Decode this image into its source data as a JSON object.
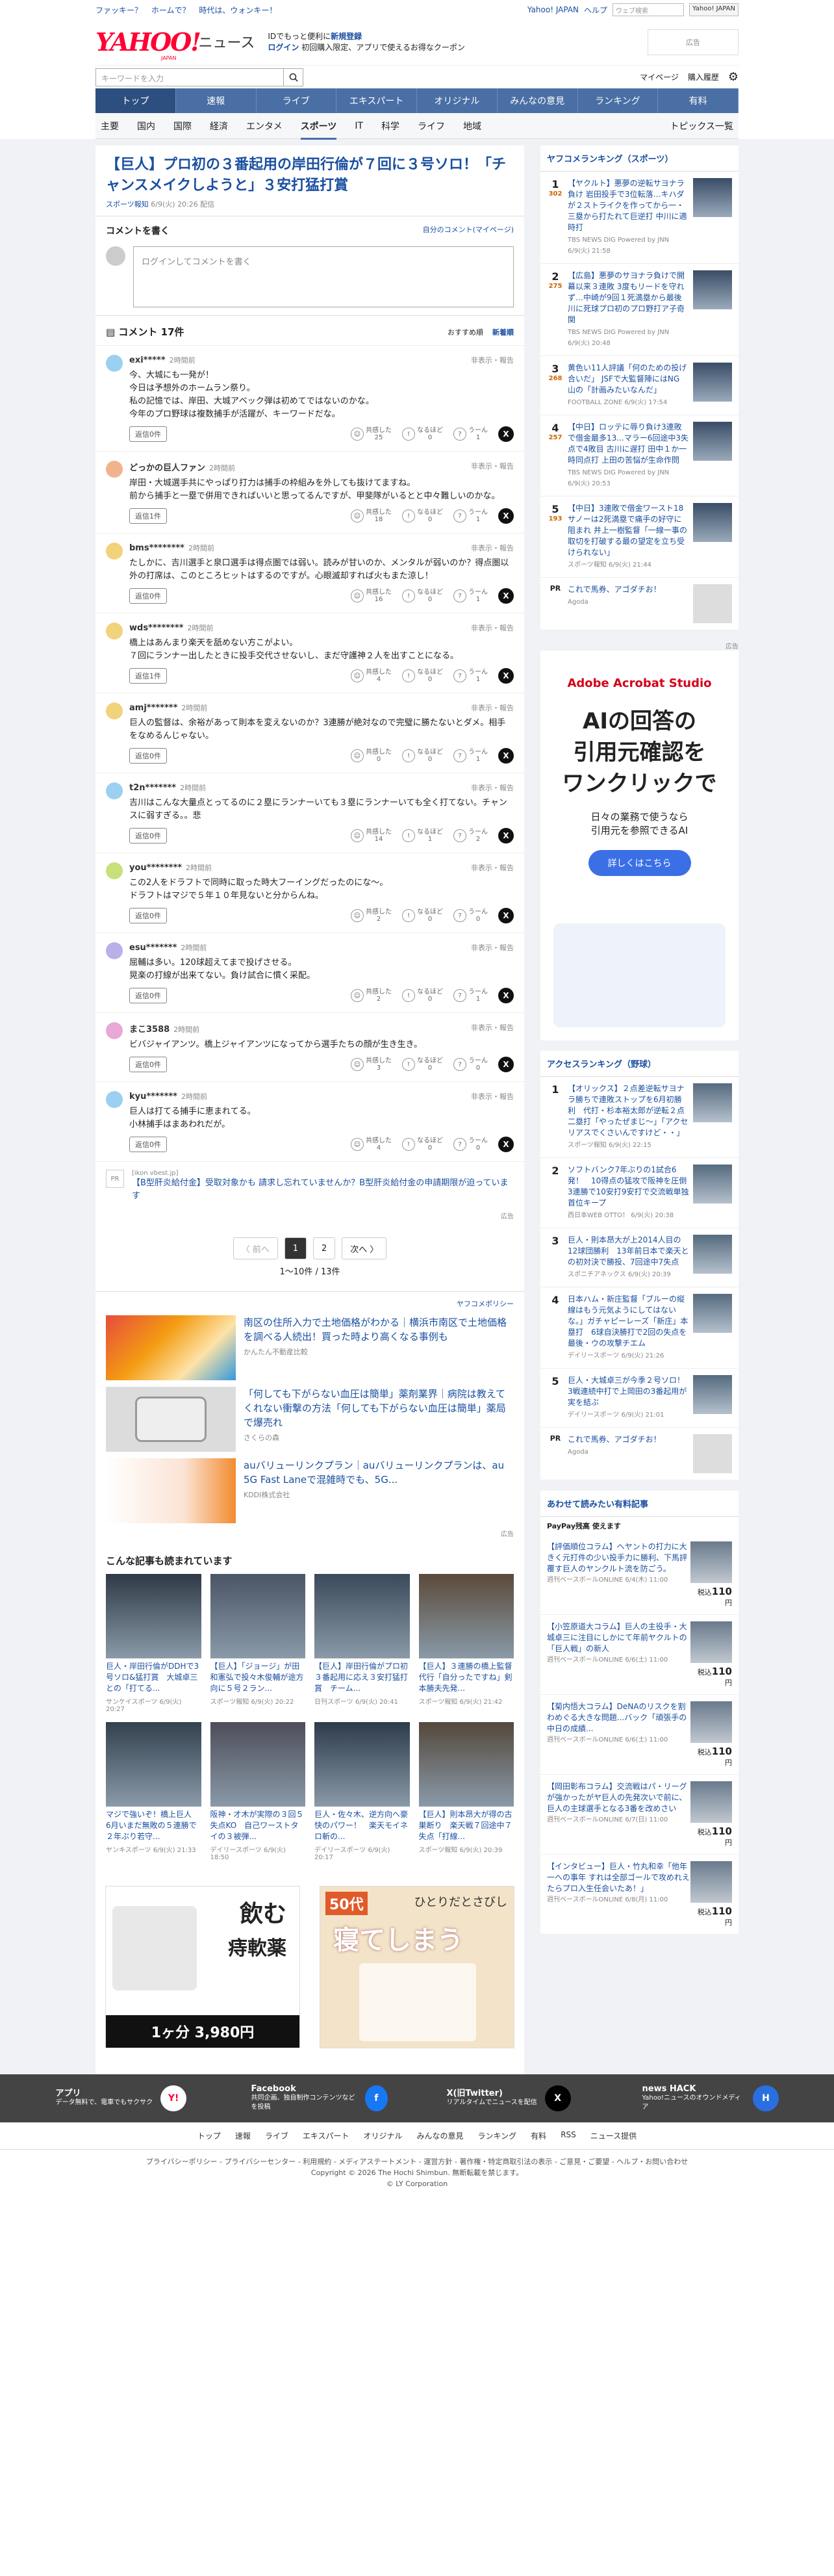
{
  "toplinks": {
    "links": [
      "ファッキー？",
      "ホームで？",
      "時代は、ウォンキー！"
    ],
    "yahoo": "Yahoo! JAPAN",
    "help": "ヘルプ",
    "search_ph": "ウェブ検索",
    "search_btn": "Yahoo! JAPAN"
  },
  "header": {
    "logo": "YAHOO!",
    "logo_sub": "JAPAN",
    "news": "ニュース",
    "info1": "IDでもっと便利に",
    "info1b": "新規登録",
    "info2": "ログイン",
    "info3": "初回購入限定、アプリで使えるお得なクーポン"
  },
  "search": {
    "placeholder": "キーワードを入力",
    "mypage": "マイページ",
    "purchase": "購入履歴"
  },
  "nav": [
    "トップ",
    "速報",
    "ライブ",
    "エキスパート",
    "オリジナル",
    "みんなの意見",
    "ランキング",
    "有料"
  ],
  "subnav": [
    "主要",
    "国内",
    "国際",
    "経済",
    "エンタメ",
    "スポーツ",
    "IT",
    "科学",
    "ライフ",
    "地域"
  ],
  "subnav_right": "トピックス一覧",
  "article": {
    "title": "【巨人】プロ初の３番起用の岸田行倫が７回に３号ソロ！「チャンスメイクしようと」３安打猛打賞",
    "source": "スポーツ報知",
    "time": "6/9(火) 20:26 配信"
  },
  "comment_write": {
    "heading": "コメントを書く",
    "own": "自分のコメント(マイページ)",
    "placeholder": "ログインしてコメントを書く"
  },
  "comments_head": {
    "count": "コメント 17件",
    "sort_rec": "おすすめ順",
    "sort_new": "新着順"
  },
  "labels": {
    "reply": "返信",
    "report": "非表示・報告",
    "kyokan": "共感した",
    "naruhodo": "なるほど",
    "uun": "うーん"
  },
  "comments": [
    {
      "user": "exi*****",
      "time": "2時間前",
      "text": "今、大城にも一発が！\n今日は予想外のホームラン祭り。\n私の記憶では、岸田、大城アベック弾は初めてではないのかな。\n今年のプロ野球は複数捕手が活躍が、キーワードだな。",
      "replies": "返信0件",
      "a": "25",
      "b": "0",
      "c": "1"
    },
    {
      "user": "どっかの巨人ファン",
      "time": "2時間前",
      "text": "岸田・大城選手共にやっぱり打力は捕手の枠組みを外しても抜けてますね。\n前から捕手と一塁で併用できればいいと思ってるんですが、甲斐隊がいるとと中々難しいのかな。",
      "replies": "返信1件",
      "a": "18",
      "b": "0",
      "c": "1"
    },
    {
      "user": "bms********",
      "time": "2時間前",
      "text": "たしかに、吉川選手と泉口選手は得点圏では弱い。読みが甘いのか、メンタルが弱いのか？得点圏以外の打席は、このところヒットはするのですが。心眼滅却すれば火もまた涼し！",
      "replies": "返信0件",
      "a": "16",
      "b": "0",
      "c": "1"
    },
    {
      "user": "wds********",
      "time": "2時間前",
      "text": "橋上はあんまり楽天を舐めない方こがよい。\n７回にランナー出したときに投手交代させないし、まだ守護神２人を出すことになる。",
      "replies": "返信1件",
      "a": "4",
      "b": "0",
      "c": "1"
    },
    {
      "user": "amj*******",
      "time": "2時間前",
      "text": "巨人の監督は、余裕があって則本を変えないのか？3連勝が絶対なので完璧に勝たないとダメ。相手をなめるんじゃない。",
      "replies": "返信0件",
      "a": "0",
      "b": "0",
      "c": "1"
    },
    {
      "user": "t2n*******",
      "time": "2時間前",
      "text": "吉川はこんな大量点とってるのに２塁にランナーいても３塁にランナーいても全く打てない。チャンスに弱すぎる。。悲",
      "replies": "返信0件",
      "a": "14",
      "b": "1",
      "c": "2"
    },
    {
      "user": "you********",
      "time": "2時間前",
      "text": "この2人をドラフトで同時に取った時大フーイングだったのにな〜。\nドラフトはマジで５年１０年見ないと分からんね。",
      "replies": "返信0件",
      "a": "2",
      "b": "0",
      "c": "0"
    },
    {
      "user": "esu*******",
      "time": "2時間前",
      "text": "屈輔は多い。120球超えてまで投げさせる。\n晃楽の打線が出来てない。負け試合に慣く采配。",
      "replies": "返信0件",
      "a": "2",
      "b": "0",
      "c": "1"
    },
    {
      "user": "まこ3588",
      "time": "2時間前",
      "text": "ビバジャイアンツ。橋上ジャイアンツになってから選手たちの顔が生き生き。",
      "replies": "返信0件",
      "a": "3",
      "b": "0",
      "c": "0"
    },
    {
      "user": "kyu*******",
      "time": "2時間前",
      "text": "巨人は打てる捕手に恵まれてる。\n小林捕手はまあわれだが。",
      "replies": "返信0件",
      "a": "4",
      "b": "0",
      "c": "0"
    }
  ],
  "promo": {
    "pr": "PR",
    "src": "[ikon vbest.jp]",
    "text": "【B型肝炎給付金】受取対象かも 請求し忘れていませんか？B型肝炎給付金の申請期限が迫っています"
  },
  "pager": {
    "prev": "〈 前へ",
    "p1": "1",
    "p2": "2",
    "next": "次へ 〉",
    "count": "1〜10件 / 13件"
  },
  "ads_label": "ヤフコメポリシー",
  "ads": [
    {
      "title": "南区の住所入力で土地価格がわかる｜横浜市南区で土地価格を調べる人続出！買った時より高くなる事例も",
      "sponsor": "かんたん不動産比較"
    },
    {
      "title": "「何しても下がらない血圧は簡単」薬剤業界｜病院は教えてくれない衝撃の方法「何しても下がらない血圧は簡単」薬局で爆売れ",
      "sponsor": "さくらの森"
    },
    {
      "title": "auバリューリンクプラン｜auバリューリンクプランは、au 5G Fast Laneで混雑時でも、5G...",
      "sponsor": "KDDI株式会社"
    }
  ],
  "also": {
    "heading": "こんな記事も読まれています",
    "items": [
      {
        "t": "巨人・岸田行倫がDDHで3号ソロ&猛打賞　大城卓三との「打てる...",
        "s": "サンケイスポーツ",
        "d": "6/9(火) 20:27"
      },
      {
        "t": "【巨人】「ジョージ」が田和憲弘で投々木俊輔が途方向に５号２ラン...",
        "s": "スポーツ報知",
        "d": "6/9(火) 20:22"
      },
      {
        "t": "【巨人】岸田行倫がプロ初３番起用に応え３安打猛打賞　チーム...",
        "s": "日刊スポーツ",
        "d": "6/9(火) 20:41"
      },
      {
        "t": "【巨人】３連勝の橋上監督代行「自分ったですね」剣本勝夫先発...",
        "s": "スポーツ報知",
        "d": "6/9(火) 21:42"
      },
      {
        "t": "マジで強いぞ！橋上巨人　6月いまだ無敗の５連勝で２年ぶり若守...",
        "s": "ヤンキスポーツ",
        "d": "6/9(火) 21:33"
      },
      {
        "t": "阪神・才木が実際の３回５失点KO　自己ワーストタイの３被弾...",
        "s": "デイリースポーツ",
        "d": "6/9(火) 18:50"
      },
      {
        "t": "巨人・佐々木、逆方向へ豪快のパワー！　楽天モイネロ斬の...",
        "s": "デイリースポーツ",
        "d": "6/9(火) 20:17"
      },
      {
        "t": "【巨人】則本昂大が得の古巣断り　楽天戦７回途中７失点「打線...",
        "s": "スポーツ報知",
        "d": "6/9(火) 20:39"
      }
    ]
  },
  "bigads": [
    {
      "t1": "飲む",
      "t2": "痔軟薬",
      "t3": "1ヶ分 3,980円",
      "label": "広告"
    },
    {
      "t1": "50代",
      "t2": "ひとりだとさびし",
      "t3": "寝てしまう",
      "label": "広告"
    }
  ],
  "side_rank": {
    "heading": "ヤフコメランキング（スポーツ）",
    "items": [
      {
        "n": "1",
        "c": "302",
        "t": "【ヤクルト】悪夢の逆転サヨナラ負け 岩田投手で3位転落…キハダが２ストライクを作ってから一・三塁から打たれて巨逆打 中川に適時打",
        "s": "TBS NEWS DIG Powered by JNN 6/9(火) 21:58"
      },
      {
        "n": "2",
        "c": "275",
        "t": "【広島】悪夢のサヨナラ負けで開幕以来３連敗 3度もリードを守れず…中崎が9回１死満塁から最後川に死球プロ初のプロ野打ア子奇関",
        "s": "TBS NEWS DIG Powered by JNN 6/9(火) 20:48"
      },
      {
        "n": "3",
        "c": "268",
        "t": "黄色い11人評議「何のための投げ合いだ」 JSFで大監督陣にはNG 山の「計画みたいなんだ」",
        "s": "FOOTBALL ZONE 6/9(火) 17:54"
      },
      {
        "n": "4",
        "c": "257",
        "t": "【中日】ロッテに辱り負け3連敗で借金最多13...マラー6回途中3失点で4敗目 古川に遅打 田中１か一時同点打 上田の苦悩が生命作問",
        "s": "TBS NEWS DIG Powered by JNN 6/9(火) 20:53"
      },
      {
        "n": "5",
        "c": "193",
        "t": "【中日】3連敗で借金ワースト18　サノーは2死満塁で痛手の好守に阻まれ 井上一樹監督「一線一事の取切を打破する最の望定を立ち受けられない」",
        "s": "スポーツ報知 6/9(火) 21:44"
      }
    ],
    "pr": "これで馬券、アゴダチお！",
    "pr_src": "Agoda"
  },
  "side_ad": {
    "brand": "Adobe Acrobat Studio",
    "h1": "AIの回答の",
    "h2": "引用元確認を",
    "h3": "ワンクリックで",
    "sub": "日々の業務で使うなら\n引用元を参照できるAI",
    "btn": "詳しくはこちら"
  },
  "side_access": {
    "heading": "アクセスランキング（野球）",
    "items": [
      {
        "n": "1",
        "t": "【オリックス】２点差逆転サヨナラ勝ちで連敗ストップを6月初勝利　代打・杉本裕太郎が逆転２点二塁打「やったぜまじ〜」「アクセリアスでくさいんですけど・・」",
        "s": "スポーツ報知 6/9(火) 22:15"
      },
      {
        "n": "2",
        "t": "ソフトバンク7年ぶりの1試合6発！　10得点の猛攻で阪神を圧倒3連勝で10安打9安打で交流戦単独首位キープ",
        "s": "西日本WEB OTTO！ 6/9(火) 20:38"
      },
      {
        "n": "3",
        "t": "巨人・則本昂大が上2014人目の12球団勝利　13年前日本で楽天との初対決で勝投、7回途中7失点",
        "s": "スポニチアネックス 6/9(火) 20:39"
      },
      {
        "n": "4",
        "t": "日本ハム・新庄監督「ブルーの縦線はもう元気ようにしてはないな。」ガチャピーレーズ「新庄」本塁打　6球自決勝打で2回の失点を最後・ウの攻撃チエム",
        "s": "デイリースポーツ 6/9(火) 21:26"
      },
      {
        "n": "5",
        "t": "巨人・大城卓三が今季２号ソロ！　3戦連続中打で上岡田の3番起用が実を結ぶ",
        "s": "デイリースポーツ 6/9(火) 21:01"
      }
    ],
    "pr": "これで馬券、アゴダチお！",
    "pr_src": "Agoda"
  },
  "side_paid": {
    "heading": "あわせて読みたい有料記事",
    "brand": "PayPay残高 使えます",
    "price_label": "税込",
    "items": [
      {
        "t": "【評価順位コラム】ヘヤントの打力に大きく元打件の少い投手力に勝利、下馬評覆す巨人のヤンクルト流を防ごう。",
        "s": "週刊ベースボールONLINE 6/4(木) 11:00",
        "p": "110"
      },
      {
        "t": "【小笠原道大コラム】巨人の主役手・大城卓三に注目にしかにて年前ヤクルトの「巨人戦」の新人",
        "s": "週刊ベースボールONLINE 6/6(土) 11:00",
        "p": "110"
      },
      {
        "t": "【菊内悟大コラム】DeNAのリスクを割わめぐる大きな問題...バック「頑張手の中日の成績...",
        "s": "週刊ベースボールONLINE 6/6(土) 11:00",
        "p": "110"
      },
      {
        "t": "【岡田彰布コラム】交流戦はパ・リーグが強かったがヤ巨人の先発次いで前に、巨人の主球選手となる3番を改めさい",
        "s": "週刊ベースボールONLINE 6/7(日) 11:00",
        "p": "110"
      },
      {
        "t": "【インタビュー】巨人・竹丸和幸「他年一への事年 すれは全部ゴールで攻めれえたらプロ入生任会いたあ！」",
        "s": "週刊ベースボールONLINE 6/8(月) 11:00",
        "p": "110"
      }
    ]
  },
  "ad_label": "広告",
  "footer": {
    "apps": [
      {
        "t": "アプリ",
        "d": "データ無料で、電車でもサクサク"
      },
      {
        "t": "Facebook",
        "d": "共同企画、独自制作コンテンツなどを投稿"
      },
      {
        "t": "X(旧Twitter)",
        "d": "リアルタイムでニュースを配信"
      },
      {
        "t": "news HACK",
        "d": "Yahoo!ニュースのオウンドメディア"
      }
    ],
    "links": [
      "トップ",
      "速報",
      "ライブ",
      "エキスパート",
      "オリジナル",
      "みんなの意見",
      "ランキング",
      "有料",
      "RSS",
      "ニュース提供"
    ],
    "bottom1": "プライバシーポリシー - プライバシーセンター - 利用規約 - メディアステートメント - 運営方針 - 著作権・特定商取引法の表示 - ご意見・ご要望 - ヘルプ・お問い合わせ",
    "bottom2": "Copyright © 2026 The Hochi Shimbun. 無断転載を禁じます。",
    "bottom3": "© LY Corporation"
  },
  "colors": {
    "accent": "#1a4fa0",
    "nav": "#4a6fa5",
    "brand_red": "#ff0033"
  }
}
